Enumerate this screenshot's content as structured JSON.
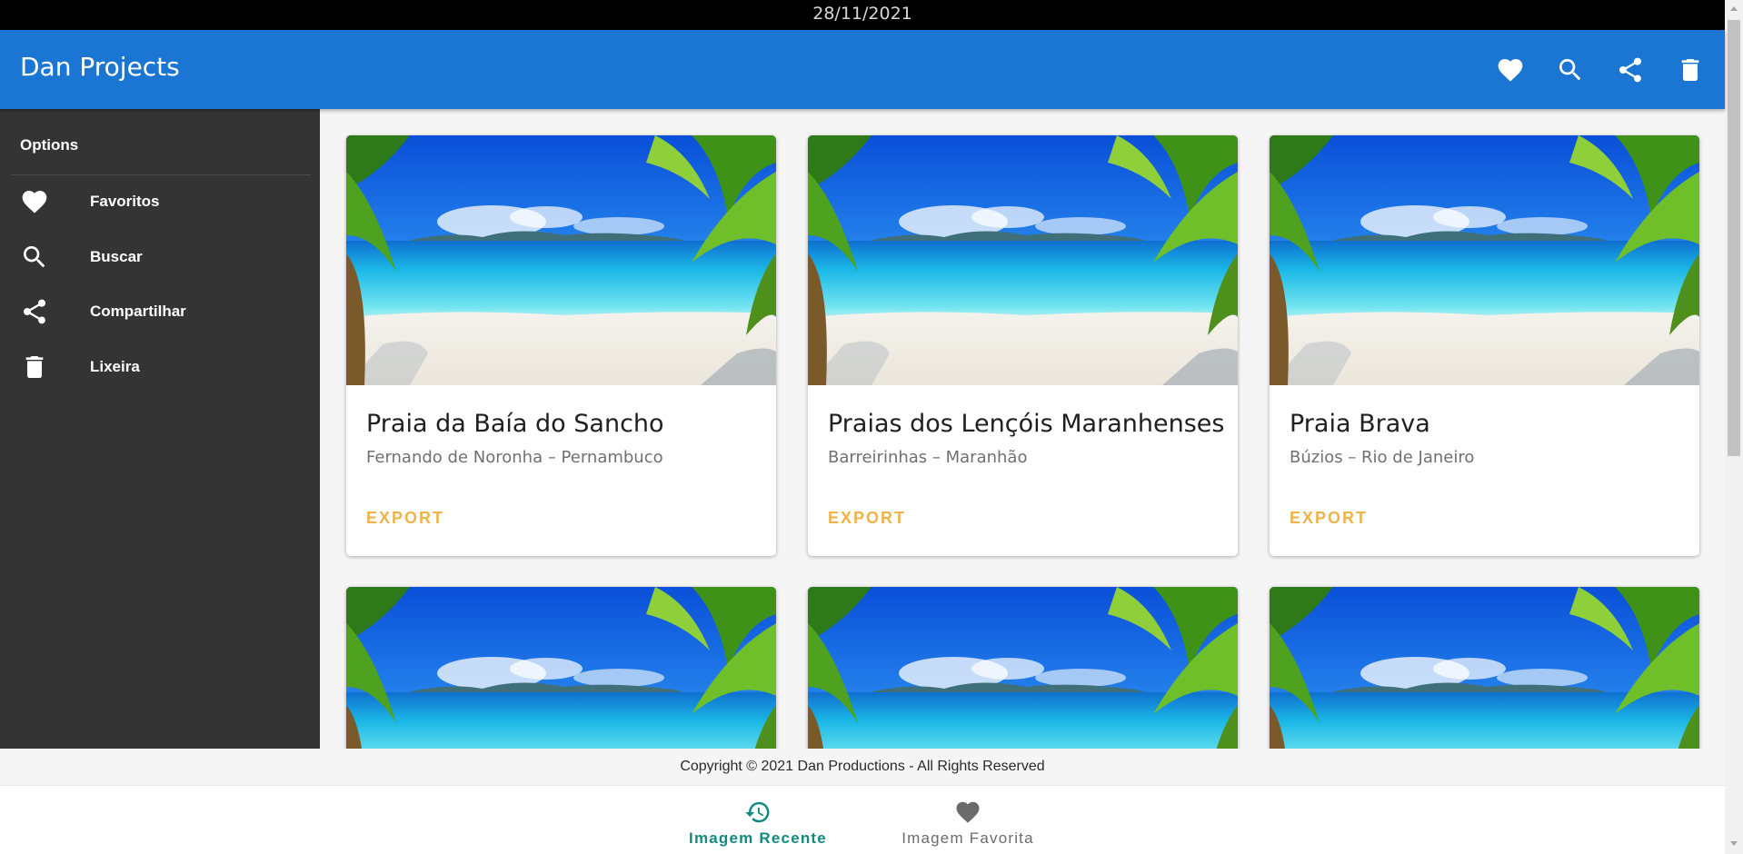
{
  "status_date": "28/11/2021",
  "app": {
    "title": "Dan Projects",
    "actions": [
      {
        "name": "favorite-action",
        "icon": "heart-icon"
      },
      {
        "name": "search-action",
        "icon": "search-icon"
      },
      {
        "name": "share-action",
        "icon": "share-icon"
      },
      {
        "name": "delete-action",
        "icon": "trash-icon"
      }
    ],
    "primary_color": "#1b76d3"
  },
  "sidebar": {
    "title": "Options",
    "items": [
      {
        "label": "Favoritos",
        "icon": "heart-icon"
      },
      {
        "label": "Buscar",
        "icon": "search-icon"
      },
      {
        "label": "Compartilhar",
        "icon": "share-icon"
      },
      {
        "label": "Lixeira",
        "icon": "trash-icon"
      }
    ]
  },
  "cards": [
    {
      "title": "Praia da Baía do Sancho",
      "subtitle": "Fernando de Noronha – Pernambuco",
      "button": "EXPORT"
    },
    {
      "title": "Praias dos Lençóis Maranhenses",
      "subtitle": "Barreirinhas – Maranhão",
      "button": "EXPORT"
    },
    {
      "title": "Praia Brava",
      "subtitle": "Búzios – Rio de Janeiro",
      "button": "EXPORT"
    },
    {
      "title": "",
      "subtitle": "",
      "button": ""
    },
    {
      "title": "",
      "subtitle": "",
      "button": ""
    },
    {
      "title": "",
      "subtitle": "",
      "button": ""
    }
  ],
  "footer": {
    "copyright": "Copyright © 2021 Dan Productions - All Rights Reserved"
  },
  "bottom_nav": {
    "items": [
      {
        "label": "Imagem Recente",
        "icon": "history-icon",
        "active": true
      },
      {
        "label": "Imagem Favorita",
        "icon": "heart-icon",
        "active": false
      }
    ],
    "active_color": "#128a80"
  },
  "accent_color": "#f0b34a"
}
